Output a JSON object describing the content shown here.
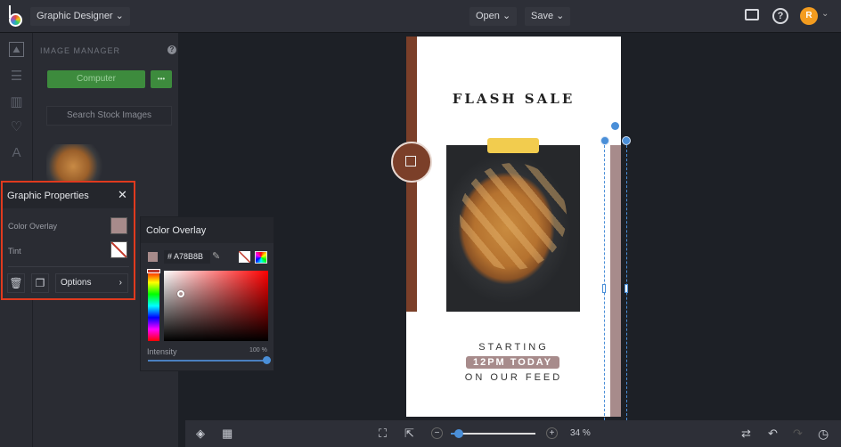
{
  "topbar": {
    "app_title": "Graphic Designer",
    "open_label": "Open",
    "save_label": "Save",
    "avatar_initial": "R"
  },
  "panel": {
    "title": "IMAGE MANAGER",
    "computer_label": "Computer",
    "more_label": "•••",
    "search_label": "Search Stock Images"
  },
  "graphic_properties": {
    "title": "Graphic Properties",
    "color_overlay_label": "Color Overlay",
    "tint_label": "Tint",
    "options_label": "Options",
    "overlay_color": "#A78B8B"
  },
  "color_overlay": {
    "title": "Color Overlay",
    "hex_prefix": "#",
    "hex_value": "A78B8B",
    "intensity_label": "Intensity",
    "intensity_value": "100 %",
    "intensity_percent": 100
  },
  "design": {
    "headline": "FLASH SALE",
    "line1": "STARTING",
    "line2": "12PM TODAY",
    "line3": "ON OUR FEED",
    "accent_brown": "#7b3f29",
    "accent_mauve": "#a78b8b",
    "tape_yellow": "#f2cc4e"
  },
  "bottombar": {
    "zoom_label": "34 %",
    "zoom_percent": 34
  }
}
